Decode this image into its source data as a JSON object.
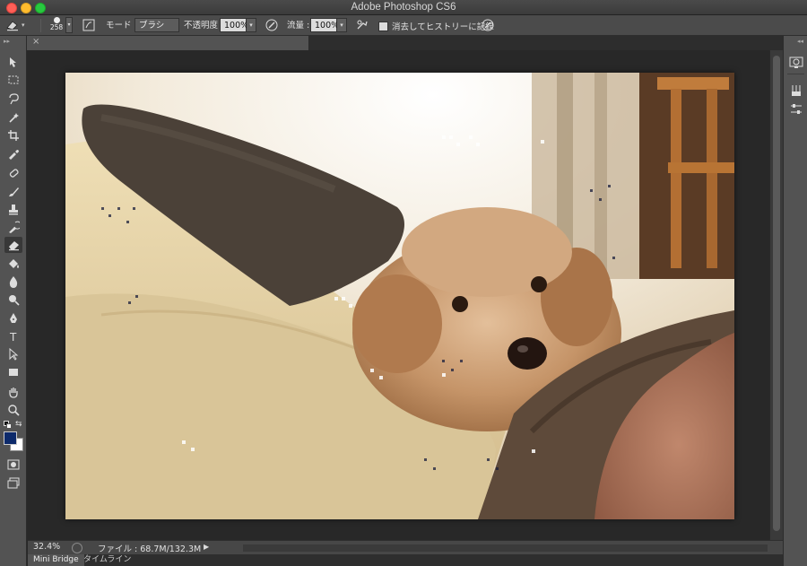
{
  "window": {
    "title": "Adobe Photoshop CS6"
  },
  "options_bar": {
    "brush_size": "258",
    "mode_label": "モード :",
    "mode_value": "ブラシ",
    "opacity_label": "不透明度 :",
    "opacity_value": "100%",
    "flow_label": "流量 :",
    "flow_value": "100%",
    "history_checkbox_label": "消去してヒストリーに記録",
    "history_checkbox_checked": false
  },
  "document_tab": {
    "close_glyph": "×"
  },
  "tools": [
    {
      "name": "move-tool-icon"
    },
    {
      "name": "marquee-tool-icon"
    },
    {
      "name": "lasso-tool-icon"
    },
    {
      "name": "quick-selection-tool-icon"
    },
    {
      "name": "crop-tool-icon"
    },
    {
      "name": "eyedropper-tool-icon"
    },
    {
      "name": "healing-brush-tool-icon"
    },
    {
      "name": "brush-tool-icon"
    },
    {
      "name": "clone-stamp-tool-icon"
    },
    {
      "name": "history-brush-tool-icon"
    },
    {
      "name": "eraser-tool-icon",
      "active": true
    },
    {
      "name": "paint-bucket-tool-icon"
    },
    {
      "name": "blur-tool-icon"
    },
    {
      "name": "dodge-tool-icon"
    },
    {
      "name": "pen-tool-icon"
    },
    {
      "name": "type-tool-icon",
      "glyph": "T"
    },
    {
      "name": "path-selection-tool-icon"
    },
    {
      "name": "rectangle-tool-icon"
    },
    {
      "name": "hand-tool-icon"
    },
    {
      "name": "zoom-tool-icon"
    }
  ],
  "colors": {
    "foreground": "#0d2a6b",
    "background": "#ffffff",
    "ui_panel": "#535353",
    "ui_dark": "#282828"
  },
  "status_bar": {
    "zoom": "32.4%",
    "file_info": "ファイル : 68.7M/132.3M",
    "play_glyph": "▶"
  },
  "bottom_tabs": [
    {
      "label": "Mini Bridge",
      "active": true
    },
    {
      "label": "タイムライン",
      "active": false
    }
  ]
}
